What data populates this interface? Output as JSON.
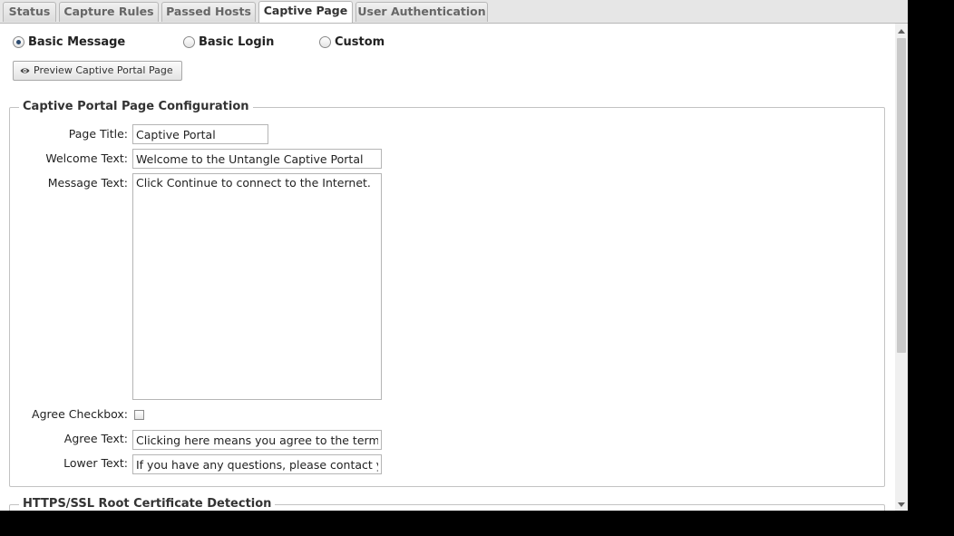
{
  "tabs": [
    {
      "label": "Status"
    },
    {
      "label": "Capture Rules"
    },
    {
      "label": "Passed Hosts"
    },
    {
      "label": "Captive Page",
      "active": true
    },
    {
      "label": "User Authentication"
    }
  ],
  "page_type": {
    "options": [
      {
        "label": "Basic Message",
        "checked": true
      },
      {
        "label": "Basic Login",
        "checked": false
      },
      {
        "label": "Custom",
        "checked": false
      }
    ]
  },
  "preview_button": {
    "label": "Preview Captive Portal Page",
    "icon": "eye-icon"
  },
  "config": {
    "legend": "Captive Portal Page Configuration",
    "page_title": {
      "label": "Page Title:",
      "value": "Captive Portal"
    },
    "welcome_text": {
      "label": "Welcome Text:",
      "value": "Welcome to the Untangle Captive Portal"
    },
    "message_text": {
      "label": "Message Text:",
      "value": "Click Continue to connect to the Internet."
    },
    "agree_checkbox": {
      "label": "Agree Checkbox:",
      "checked": false
    },
    "agree_text": {
      "label": "Agree Text:",
      "value": "Clicking here means you agree to the terms above."
    },
    "lower_text": {
      "label": "Lower Text:",
      "value": "If you have any questions, please contact your network administrator."
    }
  },
  "https": {
    "legend": "HTTPS/SSL Root Certificate Detection"
  },
  "colors": {
    "accent": "#2b4a6f",
    "tab_bg": "#dcdcdc",
    "border": "#b7b7b7"
  }
}
